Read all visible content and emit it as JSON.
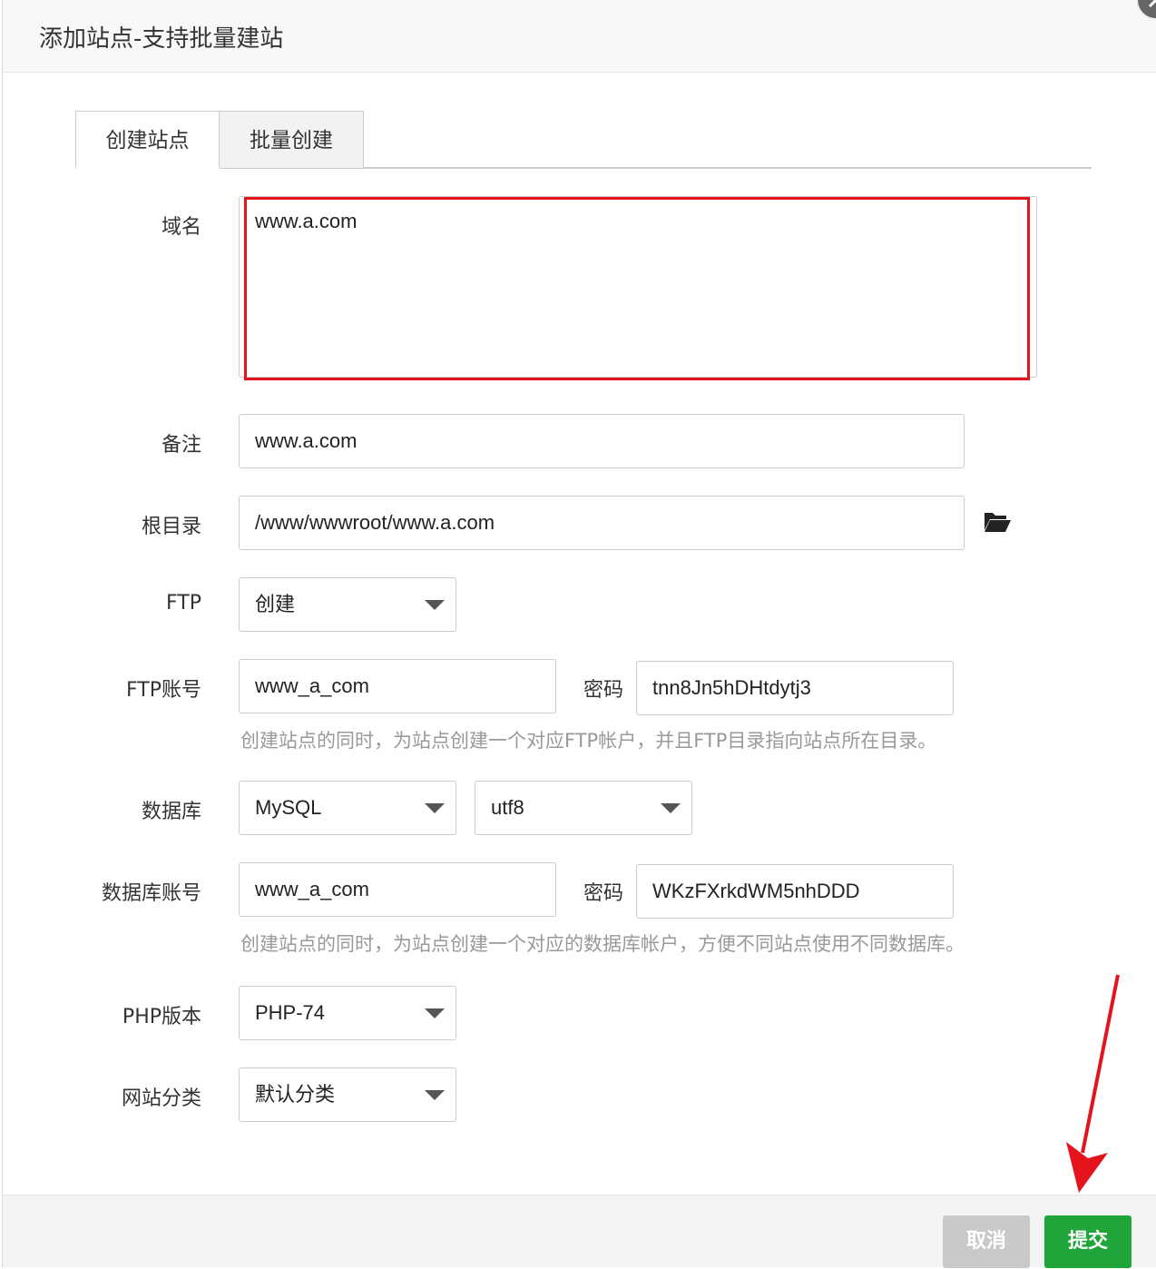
{
  "dialog": {
    "title": "添加站点-支持批量建站"
  },
  "tabs": [
    {
      "label": "创建站点",
      "active": true
    },
    {
      "label": "批量创建",
      "active": false
    }
  ],
  "form": {
    "domain": {
      "label": "域名",
      "value": "www.a.com",
      "highlight_color": "#e4131c"
    },
    "note": {
      "label": "备注",
      "value": "www.a.com"
    },
    "root": {
      "label": "根目录",
      "value": "/www/wwwroot/www.a.com",
      "icon": "folder-open-icon"
    },
    "ftp": {
      "label": "FTP",
      "selected": "创建"
    },
    "ftp_account": {
      "label": "FTP账号",
      "username": "www_a_com",
      "password_label": "密码",
      "password": "tnn8Jn5hDHtdytj3",
      "hint": "创建站点的同时，为站点创建一个对应FTP帐户，并且FTP目录指向站点所在目录。"
    },
    "database": {
      "label": "数据库",
      "type": "MySQL",
      "charset": "utf8"
    },
    "db_account": {
      "label": "数据库账号",
      "username": "www_a_com",
      "password_label": "密码",
      "password": "WKzFXrkdWM5nhDDD",
      "hint": "创建站点的同时，为站点创建一个对应的数据库帐户，方便不同站点使用不同数据库。"
    },
    "php": {
      "label": "PHP版本",
      "selected": "PHP-74"
    },
    "category": {
      "label": "网站分类",
      "selected": "默认分类"
    }
  },
  "footer": {
    "cancel_label": "取消",
    "submit_label": "提交"
  },
  "colors": {
    "submit": "#20a53a",
    "cancel": "#c9c9c9",
    "annotation": "#e4131c"
  }
}
